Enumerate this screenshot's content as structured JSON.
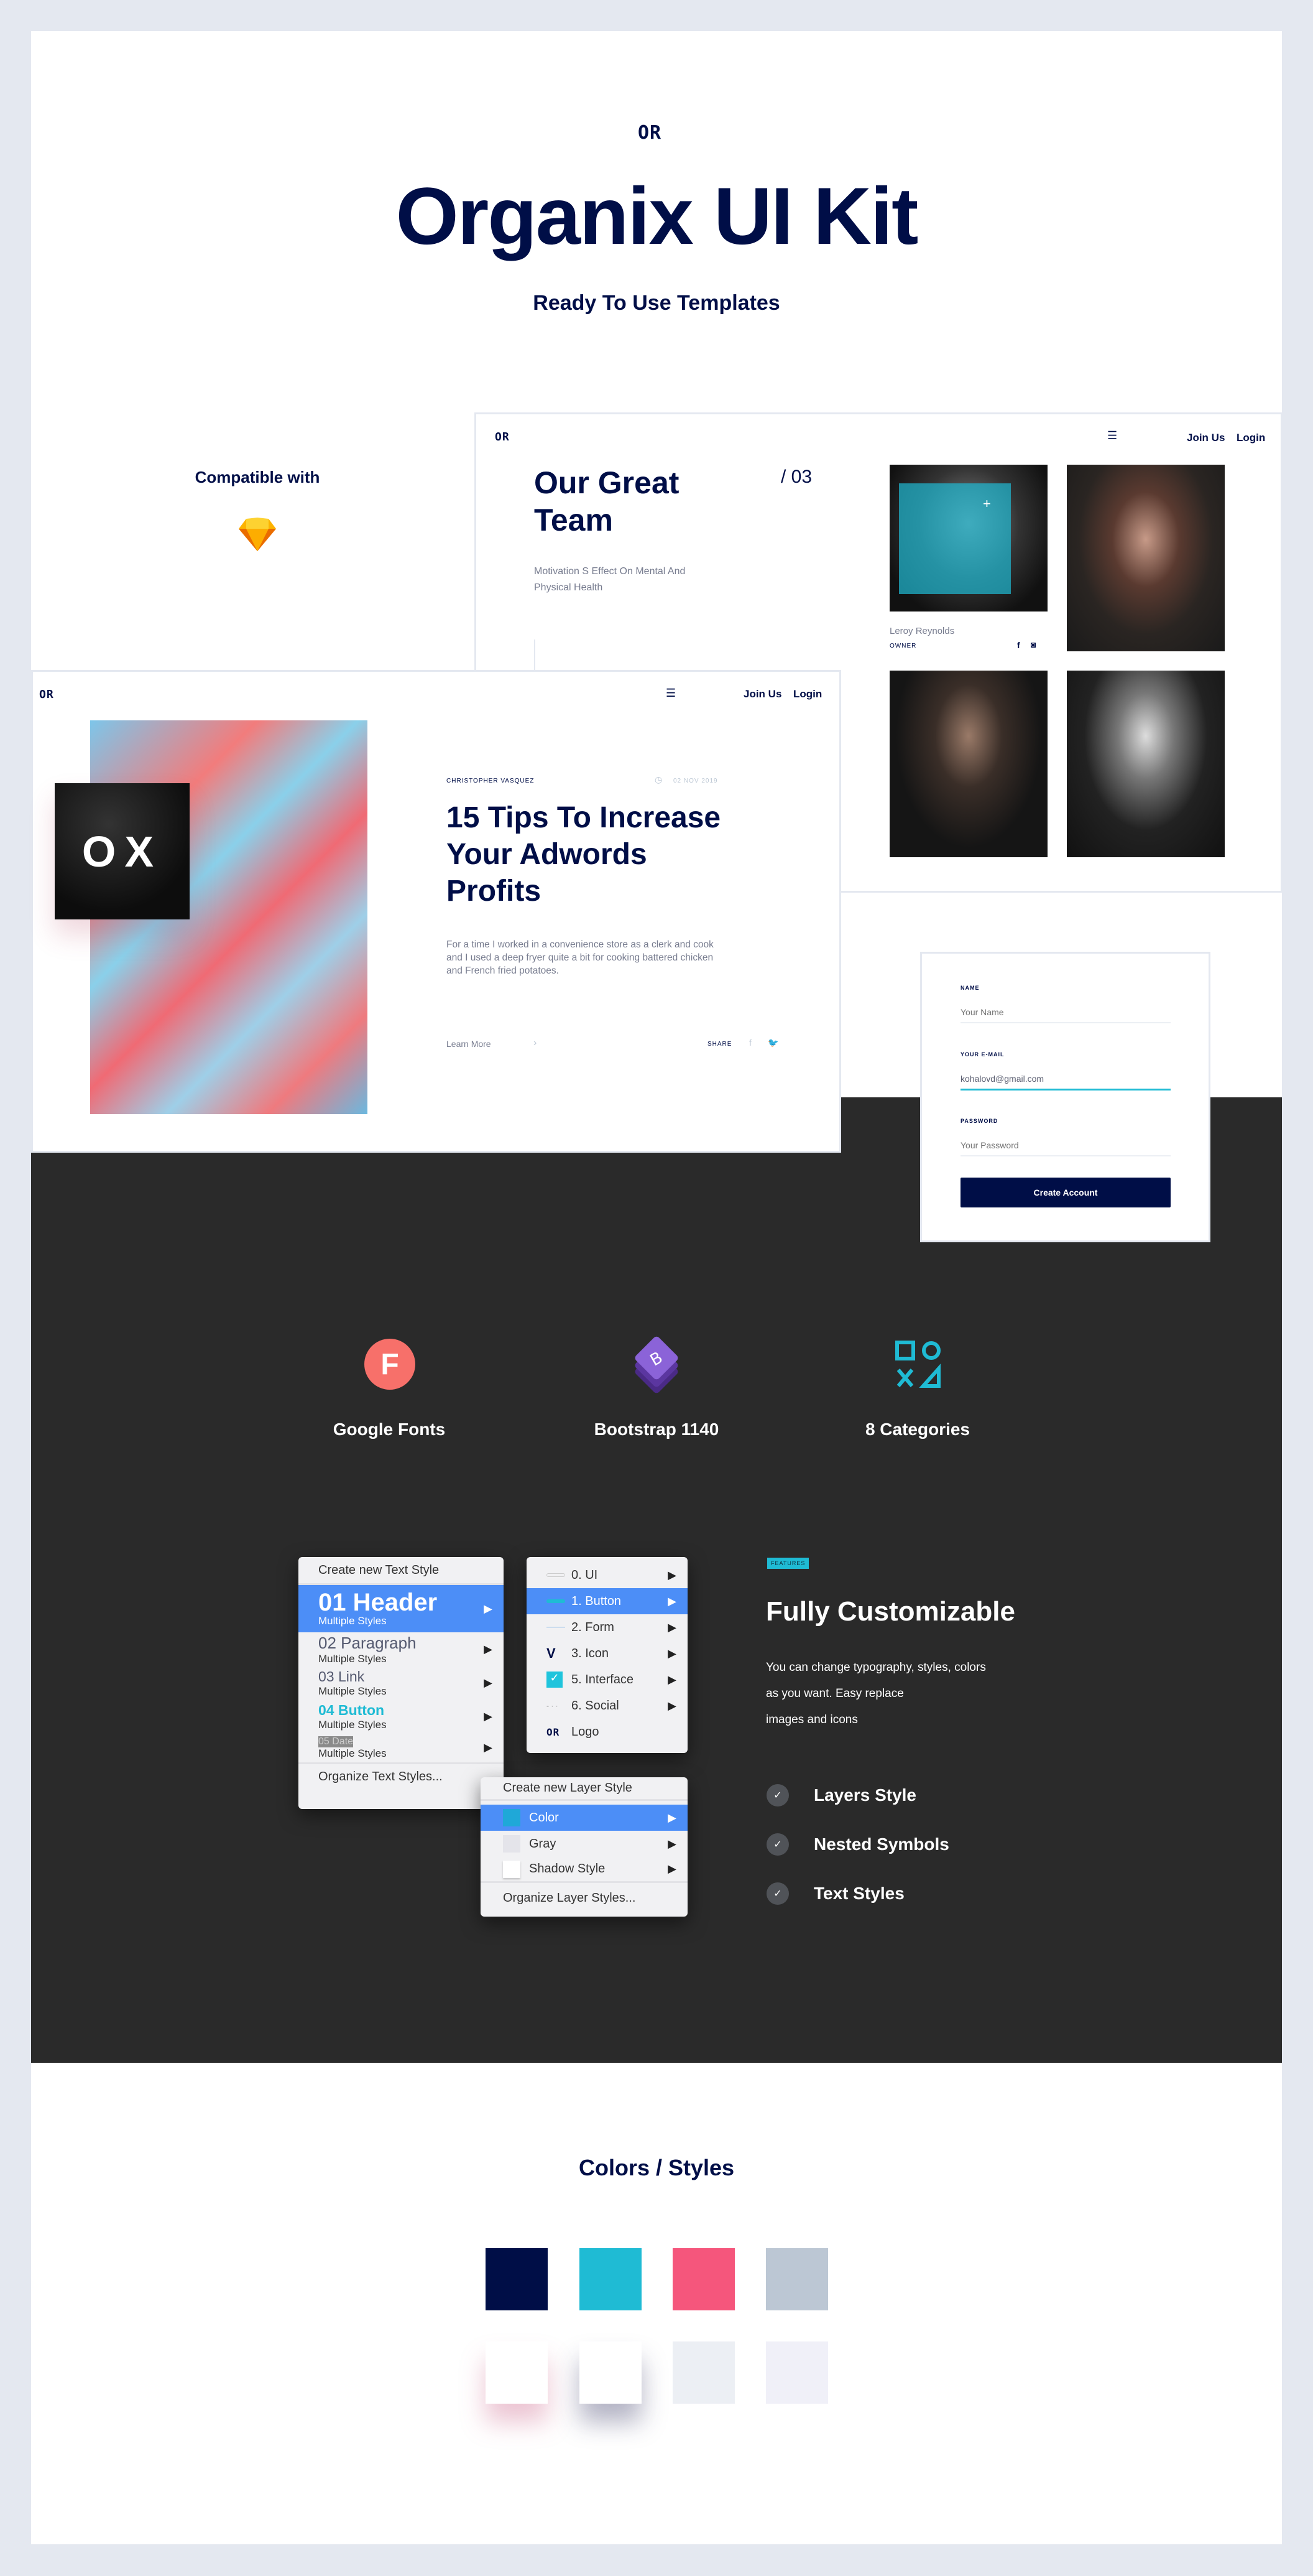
{
  "header": {
    "logo": "OR",
    "title": "Organix UI Kit",
    "subtitle": "Ready To Use Templates"
  },
  "compat": {
    "label": "Compatible with",
    "icon": "sketch-icon"
  },
  "team_card": {
    "logo": "OR",
    "nav": [
      "Join Us",
      "Login"
    ],
    "title_lines": [
      "Our Great",
      "Team"
    ],
    "index": "/ 03",
    "description_lines": [
      "Motivation S Effect On Mental And",
      "Physical Health"
    ],
    "member": {
      "name": "Leroy Reynolds",
      "role": "OWNER"
    }
  },
  "blog_card": {
    "logo": "OR",
    "nav": [
      "Join Us",
      "Login"
    ],
    "badge": "OX",
    "author": "CHRISTOPHER VASQUEZ",
    "date": "02 NOV 2019",
    "title_lines": [
      "15 Tips To Increase",
      "Your Adwords",
      "Profits"
    ],
    "body_lines": [
      "For a time I worked in a convenience store as a clerk and cook",
      "and I used a deep fryer quite a bit for cooking battered chicken",
      "and French fried potatoes."
    ],
    "learn_more": "Learn More",
    "share": "SHARE"
  },
  "form": {
    "name_label": "NAME",
    "name_placeholder": "Your Name",
    "email_label": "YOUR E-MAIL",
    "email_value": "kohalovd@gmail.com",
    "password_label": "PASSWORD",
    "password_placeholder": "Your Password",
    "submit": "Create Account"
  },
  "features_icons": [
    {
      "label": "Google Fonts",
      "icon": "google-fonts-icon",
      "letter": "F"
    },
    {
      "label": "Bootstrap 1140",
      "icon": "bootstrap-icon",
      "letter": "B"
    },
    {
      "label": "8 Categories",
      "icon": "categories-icon"
    }
  ],
  "text_styles_menu": {
    "create": "Create new Text Style",
    "items": [
      {
        "title": "01 Header",
        "sub": "Multiple Styles"
      },
      {
        "title": "02 Paragraph",
        "sub": "Multiple Styles"
      },
      {
        "title": "03 Link",
        "sub": "Multiple Styles"
      },
      {
        "title": "04 Button",
        "sub": "Multiple Styles"
      },
      {
        "title": "05 Date",
        "sub": "Multiple Styles"
      }
    ],
    "organize": "Organize Text Styles..."
  },
  "symbols_menu": {
    "items": [
      "0. UI",
      "1. Button",
      "2. Form",
      "3. Icon",
      "5. Interface",
      "6. Social",
      "Logo"
    ]
  },
  "layer_styles_menu": {
    "create": "Create new Layer Style",
    "items": [
      "Color",
      "Gray",
      "Shadow Style"
    ],
    "organize": "Organize Layer Styles..."
  },
  "customize": {
    "badge": "FEATURES",
    "title": "Fully Customizable",
    "body_lines": [
      "You can change typography, styles, colors",
      "as you want. Easy replace",
      "images and icons"
    ],
    "checks": [
      "Layers Style",
      "Nested Symbols",
      "Text Styles"
    ]
  },
  "colors": {
    "title": "Colors / Styles",
    "swatches": [
      "#000e47",
      "#1fbbd4",
      "#f5567c",
      "#bcc7d4",
      "#ffffff",
      "#ffffff",
      "#eceff4",
      "#f0f0f8"
    ]
  }
}
